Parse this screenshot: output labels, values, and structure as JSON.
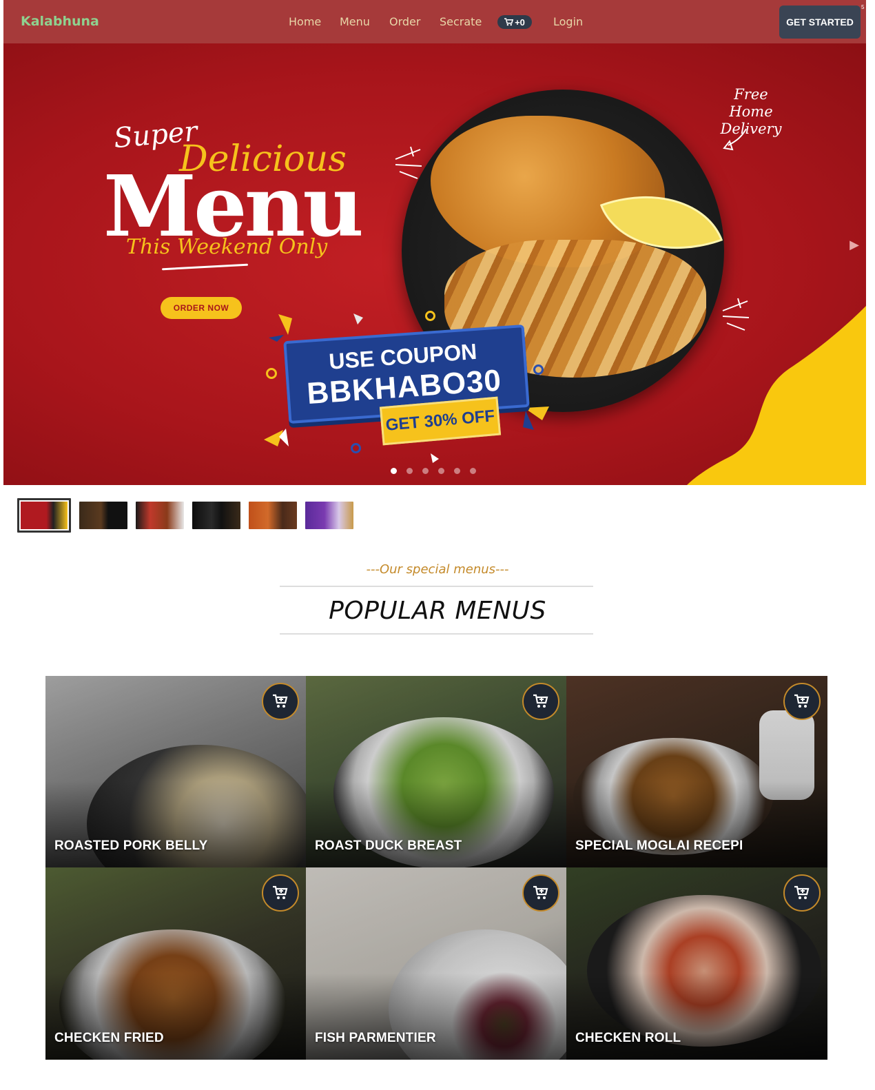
{
  "navbar": {
    "brand": "Kalabhuna",
    "links": [
      "Home",
      "Menu",
      "Order",
      "Secrate"
    ],
    "cart_count": "+0",
    "login": "Login",
    "cta": "GET STARTED",
    "corner_mark": "5"
  },
  "hero": {
    "super": "Super",
    "delicious": "Delicious",
    "menu": "Menu",
    "weekend": "This Weekend Only",
    "order_button": "ORDER NOW",
    "free_delivery": "Free Home Delivery",
    "coupon_use": "USE COUPON",
    "coupon_code": "BBKHABO30",
    "coupon_off": "GET 30% OFF",
    "slide_count": 6,
    "active_slide": 1,
    "accent_red": "#a8151b",
    "accent_yellow": "#f6c21c",
    "accent_blue": "#1f3f8f"
  },
  "section": {
    "subtitle": "---Our special menus---",
    "title": "POPULAR MENUS"
  },
  "menu_items": [
    {
      "name": "ROASTED PORK BELLY",
      "icon": "add-to-cart-icon"
    },
    {
      "name": "ROAST DUCK BREAST",
      "icon": "add-to-cart-icon"
    },
    {
      "name": "SPECIAL MOGLAI RECEPI",
      "icon": "add-to-cart-icon"
    },
    {
      "name": "CHECKEN FRIED",
      "icon": "add-to-cart-icon"
    },
    {
      "name": "FISH PARMENTIER",
      "icon": "add-to-cart-icon"
    },
    {
      "name": "CHECKEN ROLL",
      "icon": "add-to-cart-icon"
    }
  ]
}
